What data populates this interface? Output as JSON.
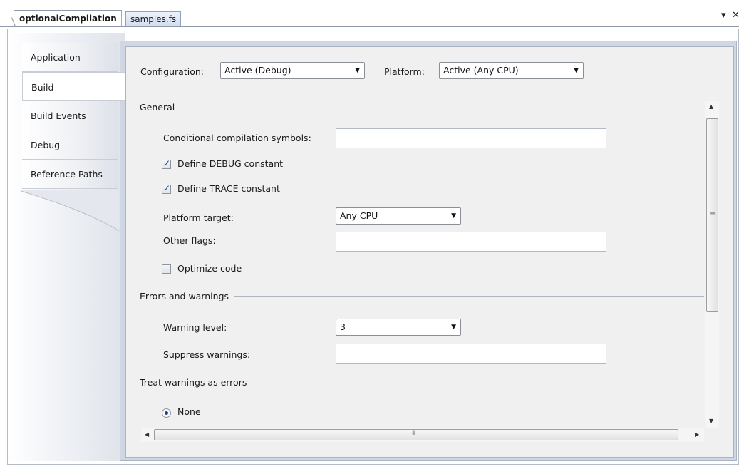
{
  "tabs": {
    "active": "optionalCompilation",
    "other": "samples.fs",
    "dropdown_glyph": "▾",
    "close_glyph": "✕"
  },
  "sidebar": {
    "items": [
      {
        "label": "Application"
      },
      {
        "label": "Build"
      },
      {
        "label": "Build Events"
      },
      {
        "label": "Debug"
      },
      {
        "label": "Reference Paths"
      }
    ],
    "selected": "Build"
  },
  "config": {
    "configuration_label": "Configuration:",
    "configuration_value": "Active (Debug)",
    "platform_label": "Platform:",
    "platform_value": "Active (Any CPU)"
  },
  "general": {
    "header": "General",
    "cond_symbols_label": "Conditional compilation symbols:",
    "cond_symbols_value": "",
    "define_debug_label": "Define DEBUG constant",
    "define_debug_checked": true,
    "define_trace_label": "Define TRACE constant",
    "define_trace_checked": true,
    "platform_target_label": "Platform target:",
    "platform_target_value": "Any CPU",
    "other_flags_label": "Other flags:",
    "other_flags_value": "",
    "optimize_label": "Optimize code",
    "optimize_checked": false
  },
  "errors": {
    "header": "Errors and warnings",
    "warning_level_label": "Warning level:",
    "warning_level_value": "3",
    "suppress_label": "Suppress warnings:",
    "suppress_value": ""
  },
  "treat": {
    "header": "Treat warnings as errors",
    "none_label": "None",
    "none_selected": true
  },
  "scroll": {
    "hgrip": "III",
    "vgrip": "≡"
  }
}
